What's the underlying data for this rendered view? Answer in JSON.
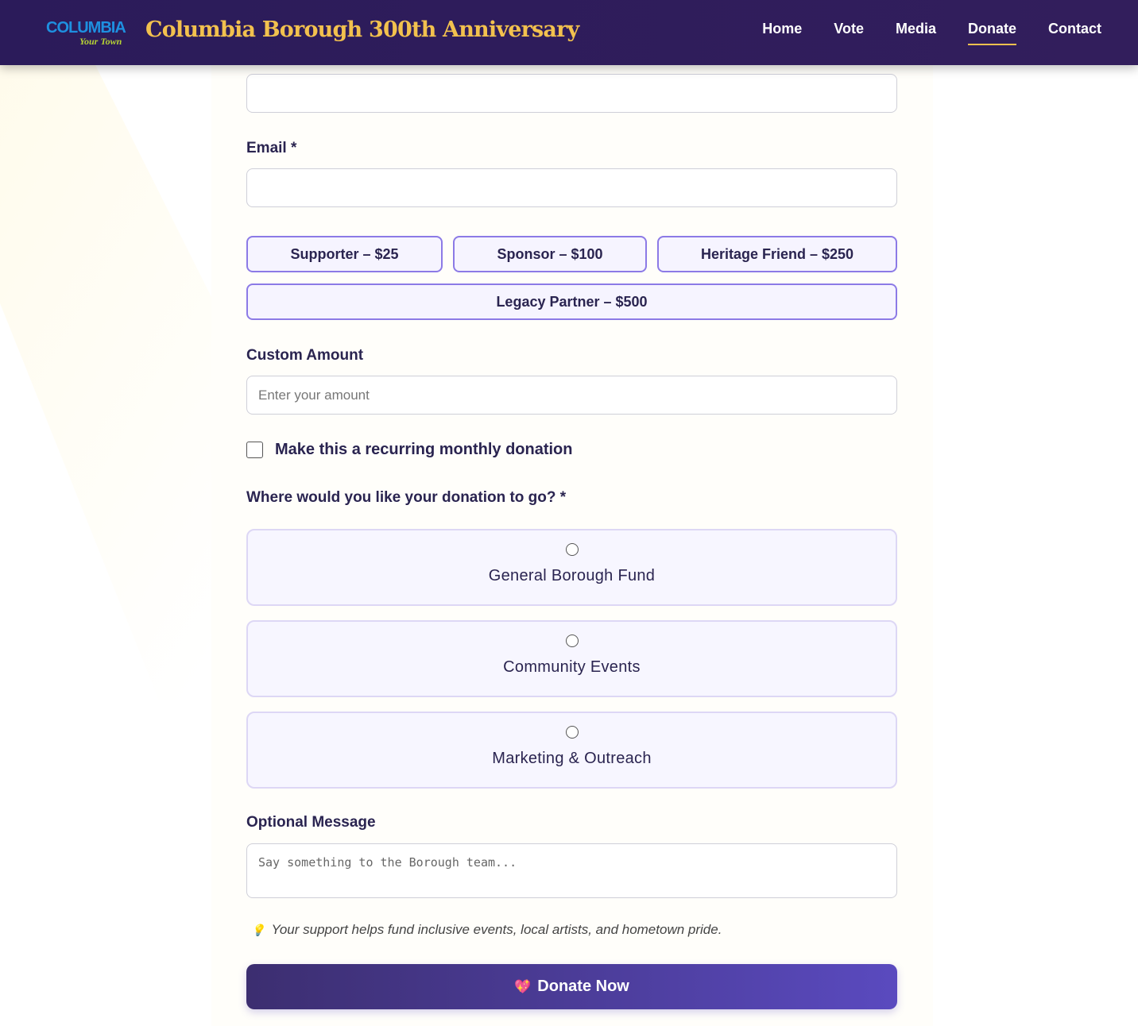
{
  "header": {
    "logo_text": "COLUMBIA",
    "logo_sub": "Your Town",
    "title": "Columbia Borough 300th Anniversary",
    "nav": [
      {
        "label": "Home"
      },
      {
        "label": "Vote"
      },
      {
        "label": "Media"
      },
      {
        "label": "Donate",
        "active": true
      },
      {
        "label": "Contact"
      }
    ]
  },
  "form": {
    "email_label": "Email *",
    "tiers": [
      {
        "label": "Supporter – $25"
      },
      {
        "label": "Sponsor – $100"
      },
      {
        "label": "Heritage Friend – $250"
      },
      {
        "label": "Legacy Partner – $500"
      }
    ],
    "custom_label": "Custom Amount",
    "custom_placeholder": "Enter your amount",
    "recurring_label": "Make this a recurring monthly donation",
    "destination_label": "Where would you like your donation to go? *",
    "destinations": [
      {
        "label": "General Borough Fund"
      },
      {
        "label": "Community Events"
      },
      {
        "label": "Marketing & Outreach"
      }
    ],
    "message_label": "Optional Message",
    "message_placeholder": "Say something to the Borough team...",
    "note": "Your support helps fund inclusive events, local artists, and hometown pride.",
    "note_icon": "💡",
    "submit_icon": "💖",
    "submit_label": "Donate Now"
  },
  "colors": {
    "header": "#2b1b5a",
    "accent": "#f2c14e",
    "tier_border": "#8c7ae6",
    "button": "#5a4abf"
  }
}
